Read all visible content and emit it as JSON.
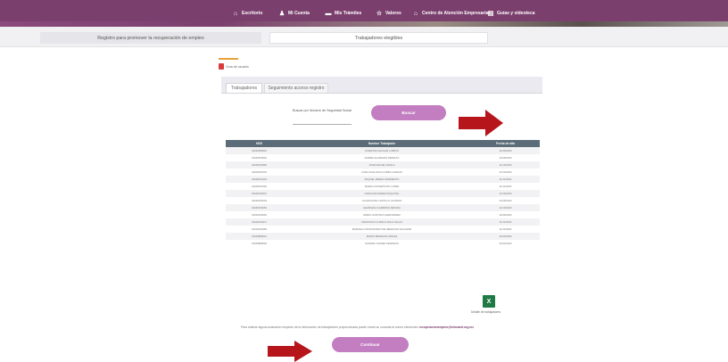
{
  "topnav": {
    "items": [
      {
        "label": "Escritorio",
        "icon": "home-icon"
      },
      {
        "label": "Mi Cuenta",
        "icon": "user-icon"
      },
      {
        "label": "Mis Trámites",
        "icon": "folder-icon"
      },
      {
        "label": "Valores",
        "icon": "star-icon"
      },
      {
        "label": "Centro de Atención Empresarial",
        "icon": "building-icon"
      },
      {
        "label": "Guías y videoteca",
        "icon": "book-icon"
      }
    ]
  },
  "subnav": {
    "left": "Registro para promover la recuperación de empleo",
    "right": "Trabajadores elegibles"
  },
  "pdf_label": "Guía de usuario",
  "tabs": {
    "trabajadores": "Trabajadores",
    "seguimiento": "Seguimiento acceso registro"
  },
  "search": {
    "label": "Buscar por Número de Seguridad Social",
    "placeholder": "",
    "button": "Buscar"
  },
  "table": {
    "headers": [
      "NSS",
      "Nombre Trabajador",
      "Fecha de alta"
    ],
    "rows": [
      [
        "01049180010",
        "JOSEFINA AGUILAR LOBATO",
        "11/05/2020"
      ],
      [
        "01049150091",
        "NORMA ALVARADO PERALTA",
        "11/05/2020"
      ],
      [
        "01049150060",
        "JOSE MIGUEL DAVILA",
        "11/10/2020"
      ],
      [
        "01049150134",
        "CARLOS ELIGIO FLORES VARGAS",
        "11/10/2020"
      ],
      [
        "01049150133",
        "RAQUEL PEREZ SARMIENTO",
        "11/11/2020"
      ],
      [
        "01049150146",
        "MARIA CONCEPCION LOPEZ",
        "11/11/2020"
      ],
      [
        "01049150207",
        "CAROLINA PEREZ ESQUIVEL",
        "11/10/2020"
      ],
      [
        "01049150225",
        "GUADALUPE CASTILLO GUZMAN",
        "11/06/2020"
      ],
      [
        "01049150252",
        "GEORGINA CARMONA RETANA",
        "11/10/2020"
      ],
      [
        "01049150263",
        "MARIO HURTADO HERNANDEZ",
        "11/06/2020"
      ],
      [
        "01049150271",
        "FRANCISCO CAMILO RAUL SALAS",
        "11/11/2020"
      ],
      [
        "01049150283",
        "MARCELO MOLDONADO DE MENDOZA SALDIVAR",
        "11/11/2020"
      ],
      [
        "01049880012",
        "MARIO MENDOZA ORDAZ",
        "20/10/2020"
      ],
      [
        "01049880093",
        "SANDRA JUAREZ SERRANO",
        "20/11/2020"
      ]
    ]
  },
  "excel": {
    "icon": "excel-icon",
    "label": "Detalle de trabajadores"
  },
  "disclaimer": {
    "text": "Para realizar alguna aclaración respecto de la información de trabajadores proporcionada puede enviar su consulta al correo electrónico ",
    "email": "recuperacionempleo@infonavit.org.mx"
  },
  "continue_button": "Continuar",
  "colors": {
    "header": "#7b3f6e",
    "button": "#c27ec0",
    "table_header": "#5b6b78",
    "arrow": "#b5151b",
    "excel": "#1f7a44"
  }
}
